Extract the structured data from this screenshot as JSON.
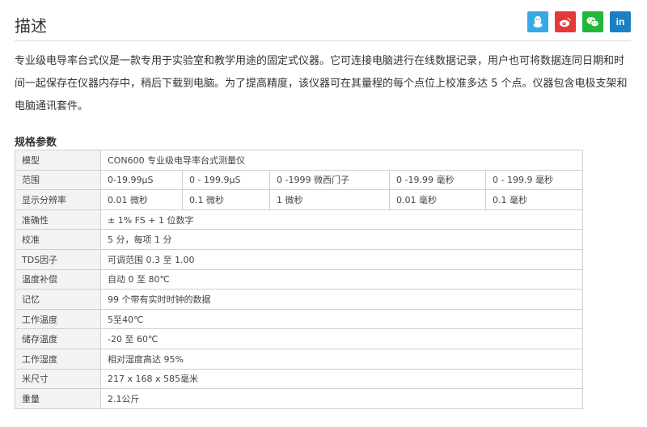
{
  "header": {
    "title": "描述",
    "share": [
      {
        "name": "qq",
        "icon": "qq-penguin-icon",
        "color": "#38a8e6"
      },
      {
        "name": "weibo",
        "icon": "weibo-icon",
        "color": "#e4393c"
      },
      {
        "name": "wechat",
        "icon": "wechat-icon",
        "color": "#20b838"
      },
      {
        "name": "linkedin",
        "icon": "linkedin-icon",
        "label": "in",
        "color": "#1b7fc3"
      }
    ]
  },
  "description": "专业级电导率台式仪是一款专用于实验室和教学用途的固定式仪器。它可连接电脑进行在线数据记录，用户也可将数据连同日期和时间一起保存在仪器内存中，稍后下载到电脑。为了提高精度，该仪器可在其量程的每个点位上校准多达 5 个点。仪器包含电极支架和电脑通讯套件。",
  "spec": {
    "title": "规格参数",
    "rows": [
      {
        "label": "模型",
        "cells": [
          "CON600 专业级电导率台式测量仪"
        ]
      },
      {
        "label": "范围",
        "cells": [
          "0-19.99µS",
          "0 - 199.9µS",
          "0 -1999 微西门子",
          "0 -19.99 毫秒",
          "0 - 199.9 毫秒"
        ]
      },
      {
        "label": "显示分辨率",
        "cells": [
          "0.01 微秒",
          "0.1 微秒",
          "1 微秒",
          "0.01 毫秒",
          "0.1 毫秒"
        ]
      },
      {
        "label": "准确性",
        "cells": [
          "± 1% FS + 1 位数字"
        ]
      },
      {
        "label": "校准",
        "cells": [
          "5 分，每项 1 分"
        ]
      },
      {
        "label": "TDS因子",
        "cells": [
          "可调范围 0.3 至 1.00"
        ]
      },
      {
        "label": "温度补偿",
        "cells": [
          "自动 0 至 80℃"
        ]
      },
      {
        "label": "记忆",
        "cells": [
          "99 个带有实时时钟的数据"
        ]
      },
      {
        "label": "工作温度",
        "cells": [
          "5至40℃"
        ]
      },
      {
        "label": "储存温度",
        "cells": [
          "-20 至 60℃"
        ]
      },
      {
        "label": "工作湿度",
        "cells": [
          "相对湿度高达 95%"
        ]
      },
      {
        "label": "米尺寸",
        "cells": [
          "217 x 168 x 585毫米"
        ]
      },
      {
        "label": "重量",
        "cells": [
          "2.1公斤"
        ]
      }
    ]
  }
}
